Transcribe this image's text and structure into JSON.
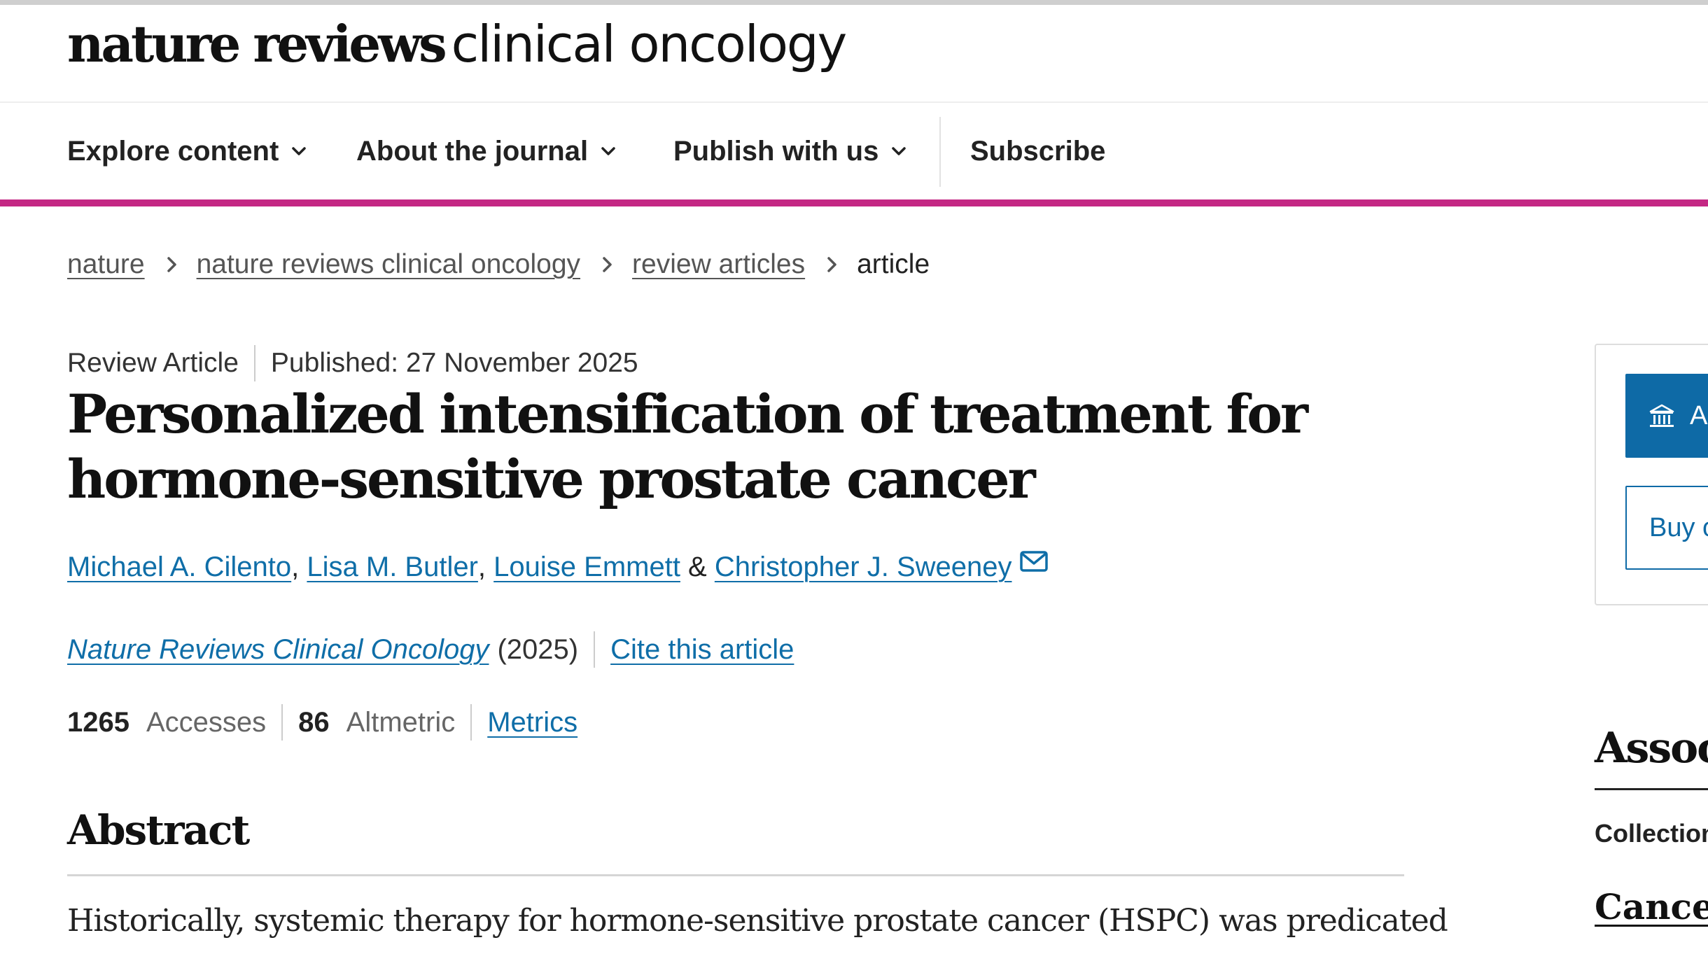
{
  "header": {
    "logo_bold": "nature reviews",
    "logo_light": "clinical oncology"
  },
  "nav": {
    "items": [
      {
        "label": "Explore content",
        "has_dropdown": true
      },
      {
        "label": "About the journal",
        "has_dropdown": true
      },
      {
        "label": "Publish with us",
        "has_dropdown": true
      },
      {
        "label": "Subscribe",
        "has_dropdown": false
      }
    ],
    "accent_color": "#c42884"
  },
  "breadcrumb": {
    "items": [
      "nature",
      "nature reviews clinical oncology",
      "review articles"
    ],
    "current": "article"
  },
  "article": {
    "type": "Review Article",
    "published": "Published: 27 November 2025",
    "title": "Personalized intensification of treatment for hormone-sensitive prostate cancer",
    "authors": [
      "Michael A. Cilento",
      "Lisa M. Butler",
      "Louise Emmett",
      "Christopher J. Sweeney"
    ],
    "author_separators": [
      ", ",
      ", ",
      " & "
    ],
    "journal": "Nature Reviews Clinical Oncology",
    "year": "(2025)",
    "cite_label": "Cite this article",
    "accesses_count": "1265",
    "accesses_label": "Accesses",
    "altmetric_count": "86",
    "altmetric_label": "Altmetric",
    "metrics_label": "Metrics",
    "abstract_heading": "Abstract",
    "abstract_text": "Historically, systemic therapy for hormone-sensitive prostate cancer (HSPC) was predicated",
    "link_color": "#0f6ea8"
  },
  "sidebar": {
    "access_button_label": "Ac",
    "buy_button_label": "Buy o",
    "associated_heading": "Assoc",
    "collection_label": "Collection",
    "collection_link": "Cancer",
    "button_color": "#0e6aa6"
  }
}
